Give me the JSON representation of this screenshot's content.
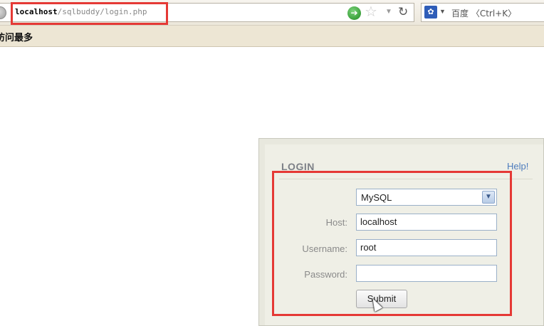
{
  "browser": {
    "url_host": "localhost",
    "url_path": "/sqlbuddy/login.php",
    "search_placeholder": "百度 〈Ctrl+K〉",
    "search_engine_icon": "baidu-paw-icon",
    "bookmark_label": "访问最多"
  },
  "login": {
    "title": "LOGIN",
    "help_label": "Help!",
    "db_type_selected": "MySQL",
    "host_label": "Host:",
    "host_value": "localhost",
    "username_label": "Username:",
    "username_value": "root",
    "password_label": "Password:",
    "password_value": "",
    "submit_label": "Submit"
  },
  "colors": {
    "highlight": "#e53935",
    "help_link": "#4d7cbd",
    "panel_bg": "#efefe6"
  }
}
